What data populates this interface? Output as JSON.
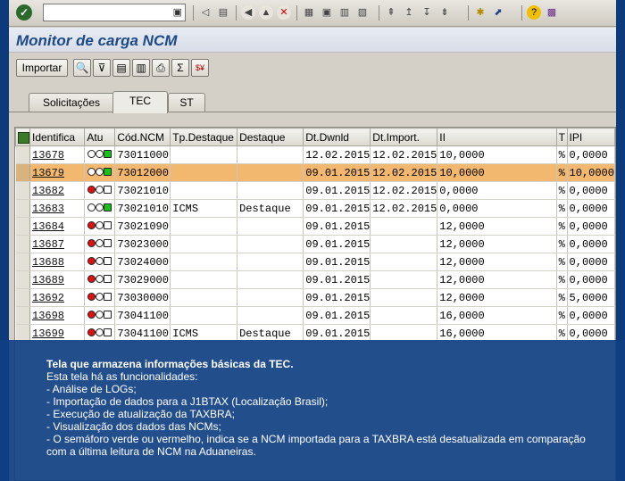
{
  "window": {
    "title": "Monitor de carga NCM"
  },
  "toolbar": {
    "importar_label": "Importar"
  },
  "tabs": [
    {
      "label": "Solicitações"
    },
    {
      "label": "TEC"
    },
    {
      "label": "ST"
    }
  ],
  "grid": {
    "columns": [
      "Identifica",
      "Atu",
      "Cód.NCM",
      "Tp.Destaque",
      "Destaque",
      "Dt.Dwnld",
      "Dt.Import.",
      "II",
      "T",
      "IPI"
    ],
    "rows": [
      {
        "id": "13678",
        "status": "green",
        "ncm": "73011000",
        "tp": "",
        "destaque": "",
        "dwnld": "12.02.2015",
        "import": "12.02.2015",
        "ii": "10,0000",
        "t": "%",
        "ipi": "0,0000"
      },
      {
        "id": "13679",
        "status": "green",
        "ncm": "73012000",
        "tp": "",
        "destaque": "",
        "dwnld": "09.01.2015",
        "import": "12.02.2015",
        "ii": "10,0000",
        "t": "%",
        "ipi": "10,0000"
      },
      {
        "id": "13682",
        "status": "red",
        "ncm": "73021010",
        "tp": "",
        "destaque": "",
        "dwnld": "09.01.2015",
        "import": "12.02.2015",
        "ii": "0,0000",
        "t": "%",
        "ipi": "0,0000"
      },
      {
        "id": "13683",
        "status": "green",
        "ncm": "73021010",
        "tp": "ICMS",
        "destaque": "Destaque",
        "dwnld": "09.01.2015",
        "import": "12.02.2015",
        "ii": "0,0000",
        "t": "%",
        "ipi": "0,0000"
      },
      {
        "id": "13684",
        "status": "red",
        "ncm": "73021090",
        "tp": "",
        "destaque": "",
        "dwnld": "09.01.2015",
        "import": "",
        "ii": "12,0000",
        "t": "%",
        "ipi": "0,0000"
      },
      {
        "id": "13687",
        "status": "red",
        "ncm": "73023000",
        "tp": "",
        "destaque": "",
        "dwnld": "09.01.2015",
        "import": "",
        "ii": "12,0000",
        "t": "%",
        "ipi": "0,0000"
      },
      {
        "id": "13688",
        "status": "red",
        "ncm": "73024000",
        "tp": "",
        "destaque": "",
        "dwnld": "09.01.2015",
        "import": "",
        "ii": "12,0000",
        "t": "%",
        "ipi": "0,0000"
      },
      {
        "id": "13689",
        "status": "red",
        "ncm": "73029000",
        "tp": "",
        "destaque": "",
        "dwnld": "09.01.2015",
        "import": "",
        "ii": "12,0000",
        "t": "%",
        "ipi": "0,0000"
      },
      {
        "id": "13692",
        "status": "red",
        "ncm": "73030000",
        "tp": "",
        "destaque": "",
        "dwnld": "09.01.2015",
        "import": "",
        "ii": "12,0000",
        "t": "%",
        "ipi": "5,0000"
      },
      {
        "id": "13698",
        "status": "red",
        "ncm": "73041100",
        "tp": "",
        "destaque": "",
        "dwnld": "09.01.2015",
        "import": "",
        "ii": "16,0000",
        "t": "%",
        "ipi": "0,0000"
      },
      {
        "id": "13699",
        "status": "red",
        "ncm": "73041100",
        "tp": "ICMS",
        "destaque": "Destaque",
        "dwnld": "09.01.2015",
        "import": "",
        "ii": "16,0000",
        "t": "%",
        "ipi": "0,0000"
      }
    ]
  },
  "caption": {
    "title": "Tela que armazena informações básicas da TEC.",
    "intro": "Esta tela há as funcionalidades:",
    "items": [
      "-   Análise de LOGs;",
      "-   Importação de dados para a J1BTAX (Localização Brasil);",
      "-   Execução de atualização da TAXBRA;",
      "-   Visualização dos dados das NCMs;",
      "-   O semáforo verde ou vermelho, indica se a NCM  importada para a TAXBRA está desatualizada em comparação com a última leitura de NCM na Aduaneiras."
    ]
  }
}
